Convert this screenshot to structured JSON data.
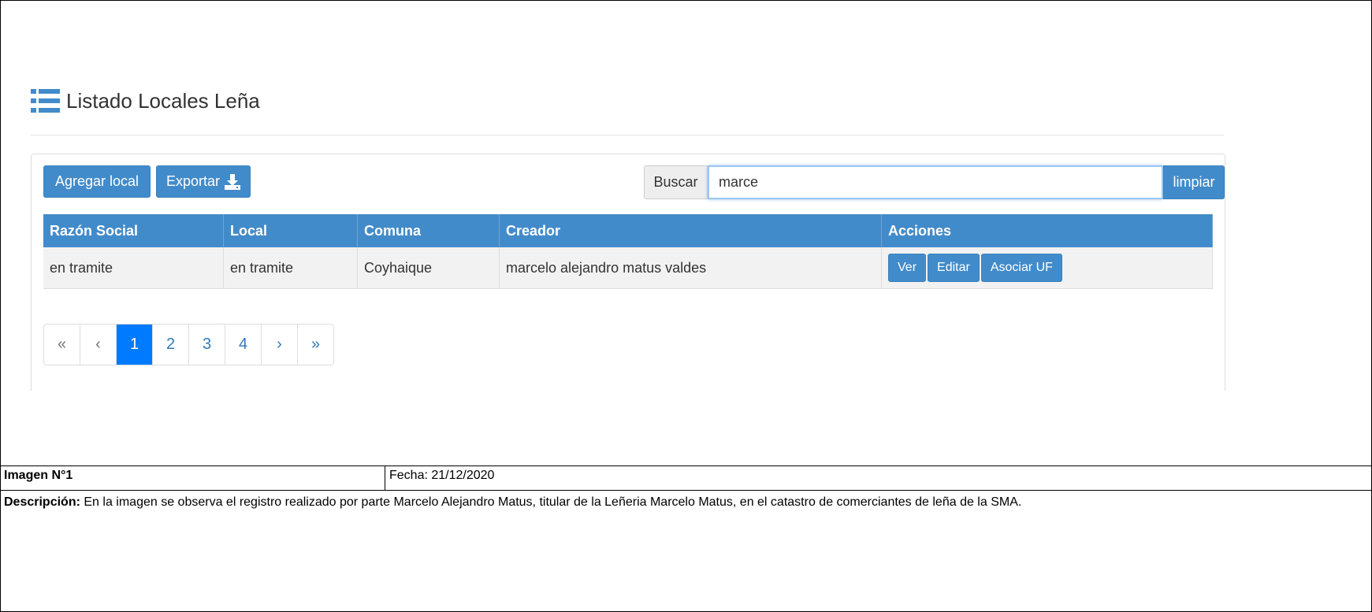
{
  "page": {
    "title": "Listado Locales Leña"
  },
  "toolbar": {
    "add_label": "Agregar local",
    "export_label": "Exportar",
    "search_label": "Buscar",
    "search_value": "marce",
    "clear_label": "limpiar"
  },
  "table": {
    "headers": [
      "Razón Social",
      "Local",
      "Comuna",
      "Creador",
      "Acciones"
    ],
    "rows": [
      {
        "razon_social": "en tramite",
        "local": "en tramite",
        "comuna": "Coyhaique",
        "creador": "marcelo alejandro matus valdes",
        "actions": [
          "Ver",
          "Editar",
          "Asociar UF"
        ]
      }
    ]
  },
  "pagination": {
    "first": "«",
    "prev": "‹",
    "pages": [
      "1",
      "2",
      "3",
      "4"
    ],
    "active_page": "1",
    "next": "›",
    "last": "»"
  },
  "caption": {
    "image_label": "Imagen N°1",
    "date": "Fecha: 21/12/2020",
    "description_label": "Descripción:",
    "description_text": " En la imagen se observa el registro realizado por parte Marcelo Alejandro Matus, titular de la Leñeria Marcelo Matus, en el catastro de comerciantes de leña de la SMA."
  },
  "colors": {
    "primary": "#428bca",
    "active_page": "#007bff",
    "link": "#337ab7"
  },
  "icons": {
    "title": "list-icon",
    "export": "download-icon"
  }
}
